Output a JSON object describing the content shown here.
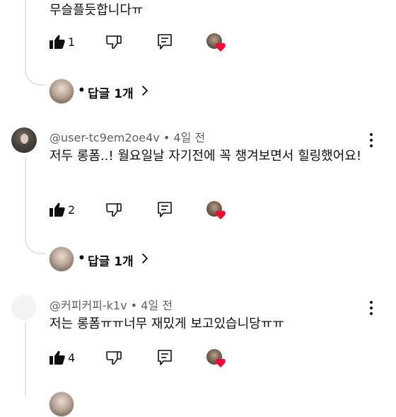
{
  "comments": [
    {
      "text": "무슬플듯합니다ㅠ",
      "likes": "1",
      "replies_label": "답글 1개"
    },
    {
      "author": "@user-tc9em2oe4v",
      "time": "4일 전",
      "text": "저두 롱폼..! 월요일날 자기전에 꼭 챙겨보면서 힐링했어요!",
      "likes": "2",
      "replies_label": "답글 1개"
    },
    {
      "author": "@커피커피-k1v",
      "time": "4일 전",
      "text": "저는 롱폼ㅠㅠ너무 재밌게 보고있습니당ㅠㅠ",
      "likes": "4"
    }
  ],
  "separator": "•",
  "icons": {
    "like": "thumbs-up-icon",
    "dislike": "thumbs-down-icon",
    "reply": "reply-icon",
    "more": "more-vert-icon",
    "creator_heart": "heart-icon",
    "chevron": "chevron-right-icon"
  },
  "colors": {
    "heart": "#ff0033",
    "meta": "#606060",
    "text": "#0f0f0f"
  }
}
